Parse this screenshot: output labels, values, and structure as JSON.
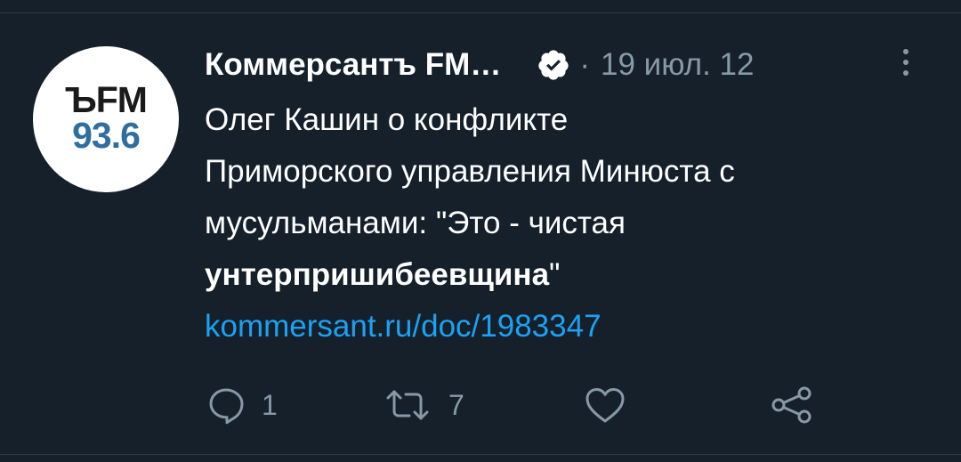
{
  "tweet": {
    "avatar": {
      "logo_line1": "ЪFM",
      "logo_line2": "93.6"
    },
    "author_name": "Коммерсантъ FM…",
    "separator": "·",
    "date": "19 июл. 12",
    "text_lines": [
      "Олег Кашин о конфликте",
      "Приморского управления Минюста с",
      "мусульманами: \"Это - чистая"
    ],
    "text_bold": "унтерпришибеевщина",
    "text_after_bold": "\"",
    "link": "kommersant.ru/doc/1983347",
    "actions": {
      "reply_count": "1",
      "retweet_count": "7"
    },
    "colors": {
      "background": "#15202b",
      "text": "#ffffff",
      "muted": "#8899a6",
      "link": "#1da1f2",
      "logo_blue": "#2f6f9f"
    },
    "icons": {
      "verified": "verified-badge-icon",
      "more": "more-vertical-icon",
      "reply": "reply-bubble-icon",
      "retweet": "retweet-icon",
      "like": "heart-icon",
      "share": "share-icon"
    }
  }
}
